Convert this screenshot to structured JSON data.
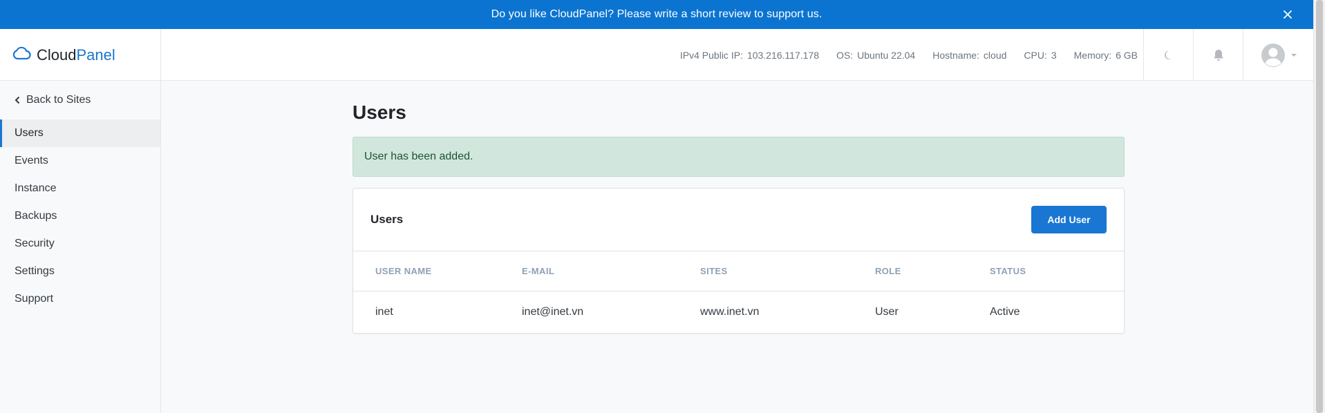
{
  "banner": {
    "message": "Do you like CloudPanel? Please write a short review to support us."
  },
  "brand": {
    "name_part1": "Cloud",
    "name_part2": "Panel",
    "logo_icon": "cloud-logo-icon"
  },
  "server_info": [
    {
      "label": "IPv4 Public IP:",
      "value": "103.216.117.178"
    },
    {
      "label": "OS:",
      "value": "Ubuntu 22.04"
    },
    {
      "label": "Hostname:",
      "value": "cloud"
    },
    {
      "label": "CPU:",
      "value": "3"
    },
    {
      "label": "Memory:",
      "value": "6 GB"
    }
  ],
  "sidebar": {
    "back_label": "Back to Sites",
    "items": [
      {
        "label": "Users",
        "active": true
      },
      {
        "label": "Events"
      },
      {
        "label": "Instance"
      },
      {
        "label": "Backups"
      },
      {
        "label": "Security"
      },
      {
        "label": "Settings"
      },
      {
        "label": "Support"
      }
    ]
  },
  "main": {
    "title": "Users",
    "alert": "User has been added.",
    "card": {
      "title": "Users",
      "add_button": "Add User",
      "columns": [
        "User Name",
        "E-Mail",
        "Sites",
        "Role",
        "Status"
      ],
      "rows": [
        [
          "inet",
          "inet@inet.vn",
          "www.inet.vn",
          "User",
          "Active"
        ]
      ]
    }
  },
  "colors": {
    "banner_bg": "#0b74d1",
    "primary": "#1976d2",
    "alert_bg": "#d1e7dd",
    "alert_text": "#1f5135",
    "header_text_muted": "#8fa0b4"
  }
}
